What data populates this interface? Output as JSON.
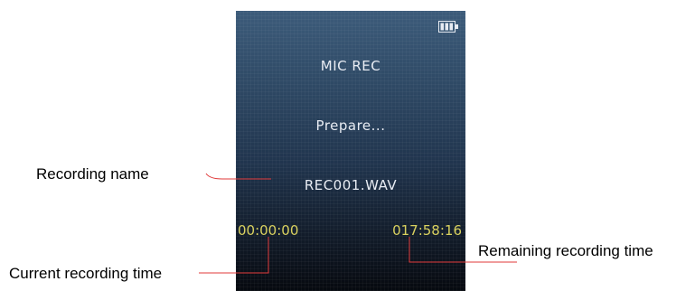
{
  "screen": {
    "title": "MIC REC",
    "status": "Prepare...",
    "filename": "REC001.WAV",
    "current_time": "00:00:00",
    "remaining_time": "017:58:16",
    "battery_icon": "battery-full-icon"
  },
  "callouts": {
    "recording_name": "Recording name",
    "current_recording_time": "Current recording time",
    "remaining_recording_time": "Remaining recording time"
  },
  "colors": {
    "time_text": "#d9d15f",
    "leader_line": "#e03a3a",
    "screen_text": "#e8ecf3"
  }
}
